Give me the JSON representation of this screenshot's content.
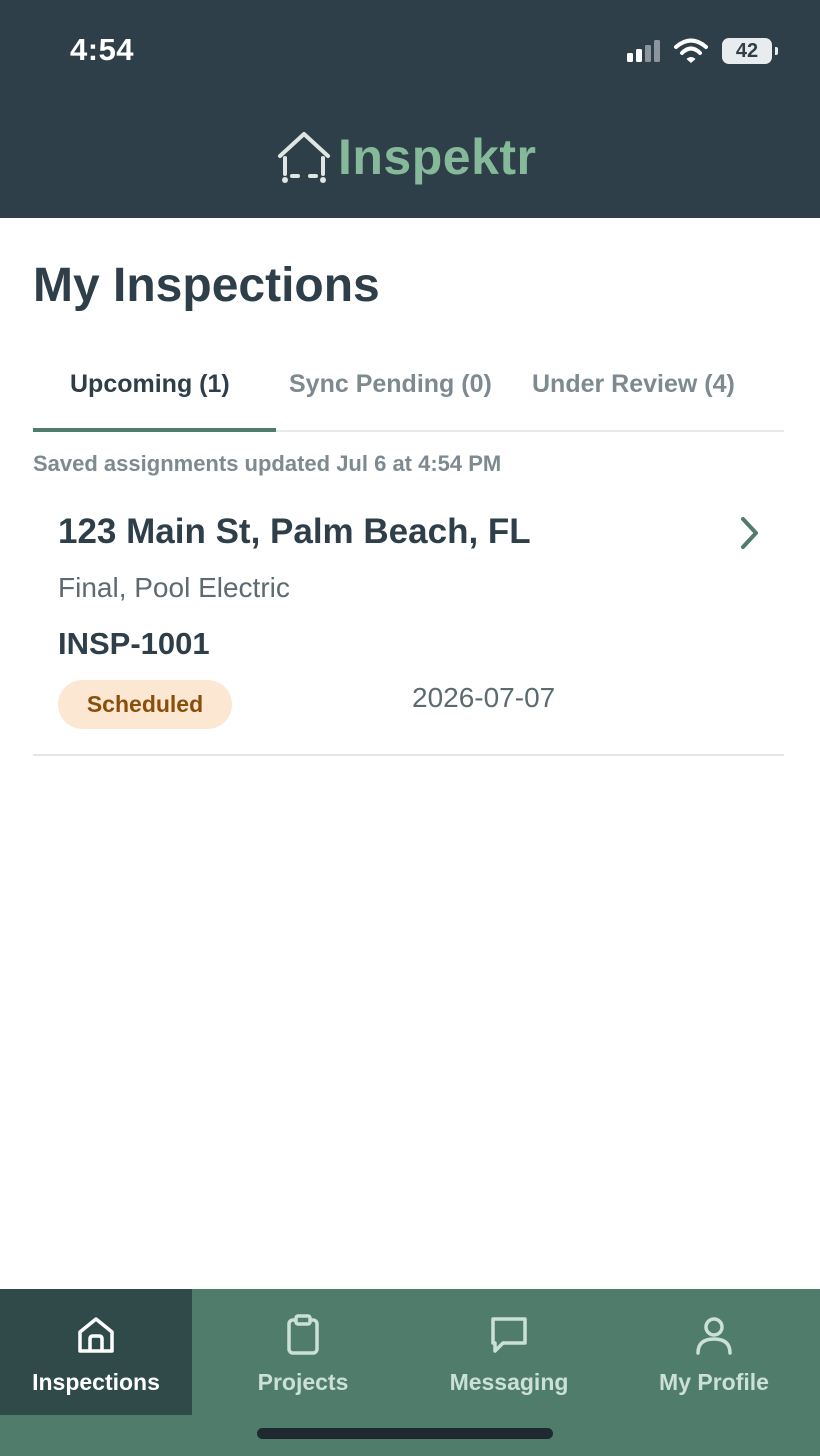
{
  "status_bar": {
    "time": "4:54",
    "battery": "42",
    "icons": [
      "signal-icon",
      "wifi-icon",
      "battery-icon"
    ]
  },
  "header": {
    "logo_text": "Inspektr",
    "logo_icon": "house-icon"
  },
  "page": {
    "title": "My Inspections"
  },
  "tabs": [
    {
      "label": "Upcoming (1)",
      "active": true
    },
    {
      "label": "Sync Pending (0)",
      "active": false
    },
    {
      "label": "Under Review (4)",
      "active": false
    }
  ],
  "saved_note": "Saved assignments updated Jul 6 at 4:54 PM",
  "inspections": [
    {
      "address": "123 Main St, Palm Beach, FL",
      "type": "Final, Pool Electric",
      "id": "INSP-1001",
      "status": "Scheduled",
      "date": "2026-07-07"
    }
  ],
  "bottom_nav": [
    {
      "label": "Inspections",
      "icon": "home-icon",
      "active": true
    },
    {
      "label": "Projects",
      "icon": "clipboard-icon",
      "active": false
    },
    {
      "label": "Messaging",
      "icon": "chat-bubble-icon",
      "active": false
    },
    {
      "label": "My Profile",
      "icon": "person-icon",
      "active": false
    }
  ],
  "colors": {
    "header_bg": "#2f3f4a",
    "brand_green": "#86b89a",
    "nav_bg": "#4f7c6b",
    "nav_active_bg": "#2f4a49",
    "badge_bg": "#fce8d2",
    "badge_text": "#8a4e0b"
  }
}
